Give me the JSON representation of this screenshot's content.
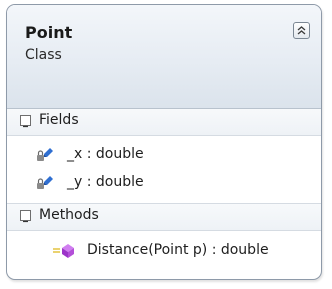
{
  "class_shape": {
    "title": "Point",
    "stereotype": "Class"
  },
  "sections": {
    "fields": {
      "label": "Fields",
      "items": [
        {
          "label": "_x : double",
          "icon": "private-field-icon"
        },
        {
          "label": "_y : double",
          "icon": "private-field-icon"
        }
      ]
    },
    "methods": {
      "label": "Methods",
      "items": [
        {
          "label": "Distance(Point p) : double",
          "icon": "public-method-icon"
        }
      ]
    }
  },
  "colors": {
    "border": "#8e9aa9",
    "header_gradient_top": "#f3f6fa",
    "header_gradient_bottom": "#dbe3ec",
    "field_icon": "#2f6fd1",
    "method_icon": "#b34fd8"
  }
}
